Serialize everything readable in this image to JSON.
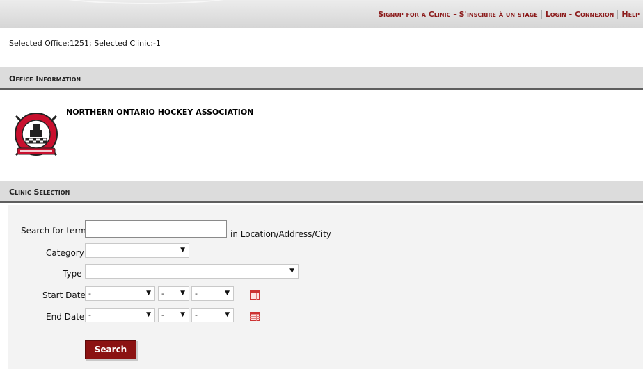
{
  "topnav": {
    "links": [
      "Signup for a Clinic - S'inscrire à un stage",
      "Login - Connexion",
      "Help"
    ]
  },
  "status_text": "Selected Office:1251; Selected Clinic:-1",
  "office_section": {
    "title": "Office Information",
    "org_name": "NORTHERN ONTARIO HOCKEY ASSOCIATION",
    "logo_text": "NORTHERN ONTARIO HOCKEY ASSOCIATION"
  },
  "clinic_section": {
    "title": "Clinic Selection",
    "search_label": "Search for term",
    "search_value": "",
    "search_suffix": "in Location/Address/City",
    "category_label": "Category",
    "category_value": "",
    "type_label": "Type",
    "type_value": "",
    "start_date_label": "Start Date",
    "start_date": {
      "year": "-",
      "month": "-",
      "day": "-"
    },
    "end_date_label": "End Date",
    "end_date": {
      "year": "-",
      "month": "-",
      "day": "-"
    },
    "search_button": "Search"
  },
  "colors": {
    "accent": "#8b1212",
    "header_bg": "#dcdcdc",
    "header_rule": "#5e5e5e"
  },
  "icons": [
    "calendar-icon",
    "dropdown-arrow-icon",
    "nohaa-logo"
  ]
}
